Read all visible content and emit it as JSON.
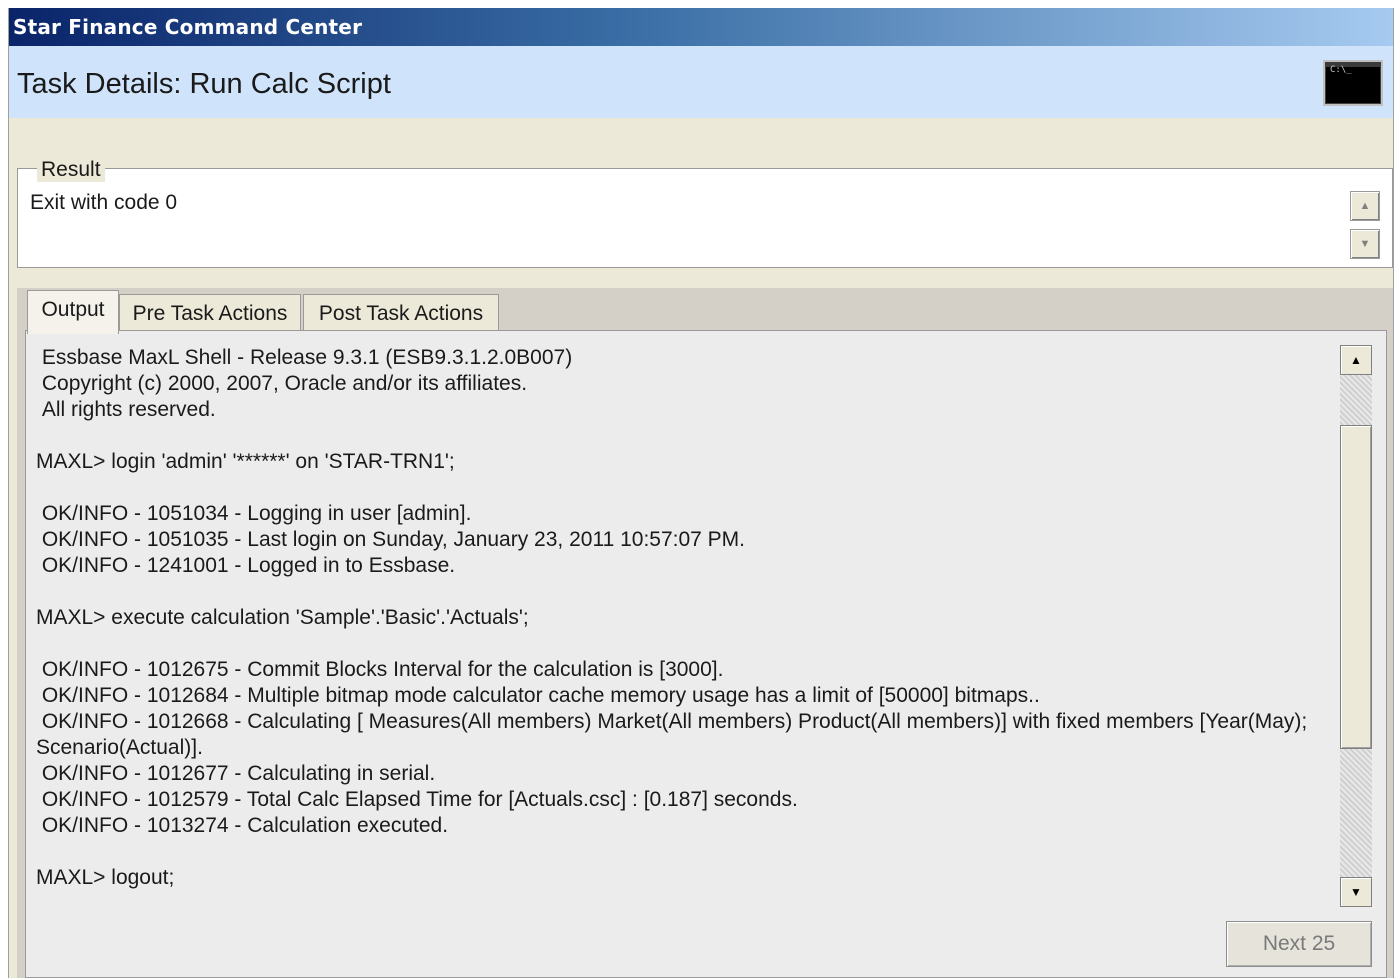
{
  "window": {
    "title": "Star Finance Command Center"
  },
  "header": {
    "title": "Task Details: Run Calc Script",
    "icon": "console-icon",
    "icon_text": "C:\\_"
  },
  "result": {
    "legend": "Result",
    "text": "Exit with code 0",
    "scroll_up": "▲",
    "scroll_down": "▼"
  },
  "tabs": [
    {
      "label": "Output",
      "active": true
    },
    {
      "label": "Pre Task Actions",
      "active": false
    },
    {
      "label": "Post Task Actions",
      "active": false
    }
  ],
  "output": {
    "lines": [
      " Essbase MaxL Shell - Release 9.3.1 (ESB9.3.1.2.0B007)",
      " Copyright (c) 2000, 2007, Oracle and/or its affiliates.",
      " All rights reserved.",
      "",
      "MAXL> login 'admin' '******' on 'STAR-TRN1';",
      "",
      " OK/INFO - 1051034 - Logging in user [admin].",
      " OK/INFO - 1051035 - Last login on Sunday, January 23, 2011 10:57:07 PM.",
      " OK/INFO - 1241001 - Logged in to Essbase.",
      "",
      "MAXL> execute calculation 'Sample'.'Basic'.'Actuals';",
      "",
      " OK/INFO - 1012675 - Commit Blocks Interval for the calculation is [3000].",
      " OK/INFO - 1012684 - Multiple bitmap mode calculator cache memory usage has a limit of [50000] bitmaps..",
      " OK/INFO - 1012668 - Calculating [ Measures(All members) Market(All members) Product(All members)] with fixed members [Year(May);",
      "Scenario(Actual)].",
      " OK/INFO - 1012677 - Calculating in serial.",
      " OK/INFO - 1012579 - Total Calc Elapsed Time for [Actuals.csc] : [0.187] seconds.",
      " OK/INFO - 1013274 - Calculation executed.",
      "",
      "MAXL> logout;"
    ],
    "scroll_up": "▲",
    "scroll_down": "▼"
  },
  "footer": {
    "next_label": "Next 25"
  }
}
